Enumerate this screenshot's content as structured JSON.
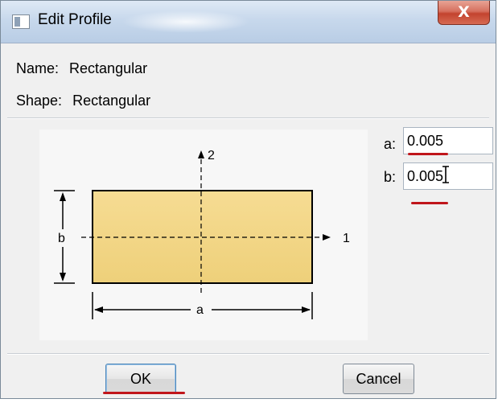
{
  "window": {
    "title": "Edit Profile",
    "close_label": "X"
  },
  "info": {
    "name_label": "Name:",
    "name_value": "Rectangular",
    "shape_label": "Shape:",
    "shape_value": "Rectangular"
  },
  "diagram": {
    "axis_1_label": "1",
    "axis_2_label": "2",
    "dim_a_label": "a",
    "dim_b_label": "b",
    "fill_color": "#f5d98a",
    "edge_color": "#000000"
  },
  "params": {
    "a_label": "a:",
    "a_value": "0.005",
    "b_label": "b:",
    "b_value": "0.005"
  },
  "buttons": {
    "ok_label": "OK",
    "cancel_label": "Cancel"
  },
  "annotation": {
    "underline_color": "#c0161b"
  }
}
